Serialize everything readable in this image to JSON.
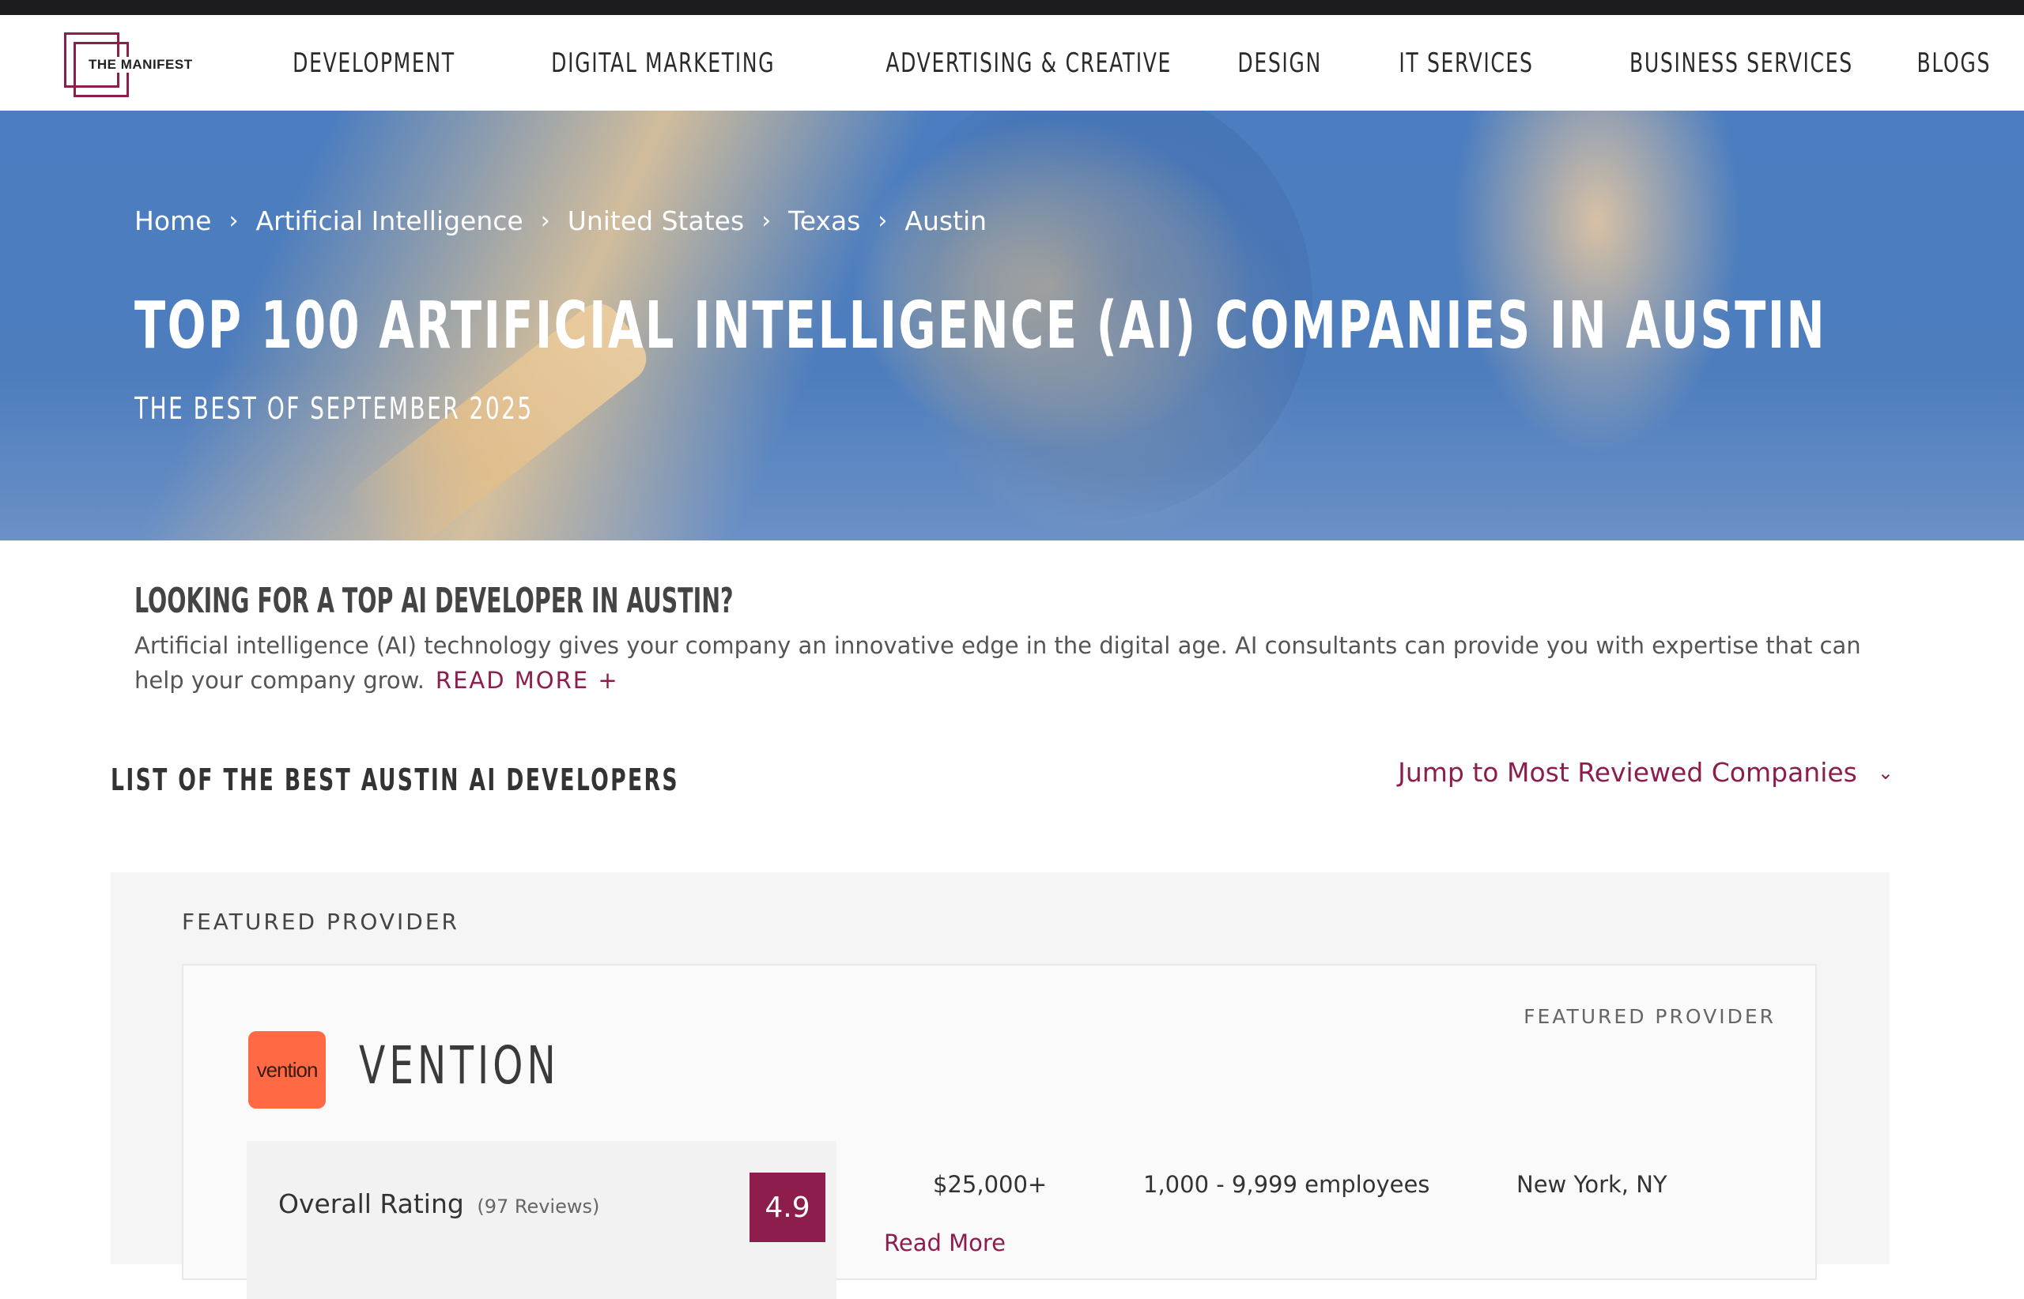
{
  "brand": {
    "logo_text": "THE MANIFEST",
    "accent_color": "#8c1d4d"
  },
  "nav": {
    "items": [
      {
        "label": "DEVELOPMENT"
      },
      {
        "label": "DIGITAL MARKETING"
      },
      {
        "label": "ADVERTISING & CREATIVE"
      },
      {
        "label": "DESIGN"
      },
      {
        "label": "IT SERVICES"
      },
      {
        "label": "BUSINESS SERVICES"
      },
      {
        "label": "BLOGS"
      }
    ]
  },
  "breadcrumb": {
    "items": [
      {
        "label": "Home"
      },
      {
        "label": "Artificial Intelligence"
      },
      {
        "label": "United States"
      },
      {
        "label": "Texas"
      },
      {
        "label": "Austin"
      }
    ],
    "separator_icon": "chevron-right-icon"
  },
  "hero": {
    "title": "TOP 100 ARTIFICIAL INTELLIGENCE (AI) COMPANIES IN AUSTIN",
    "subtitle": "THE BEST OF SEPTEMBER 2025"
  },
  "intro": {
    "heading": "LOOKING FOR A TOP AI DEVELOPER IN AUSTIN?",
    "body": "Artificial intelligence (AI) technology gives your company an innovative edge in the digital age. AI consultants can provide you with expertise that can help your company grow.",
    "read_more": "READ MORE +"
  },
  "list": {
    "heading": "LIST OF THE BEST AUSTIN AI DEVELOPERS",
    "jump_label": "Jump to Most Reviewed Companies",
    "jump_icon": "chevron-down-icon"
  },
  "featured": {
    "section_label": "FEATURED PROVIDER",
    "card": {
      "tag": "FEATURED PROVIDER",
      "logo_text": "vention",
      "logo_color": "#ff6a45",
      "company_name": "VENTION",
      "rating_label": "Overall Rating",
      "review_count": "(97 Reviews)",
      "score": "4.9",
      "min_project": "$25,000+",
      "employees": "1,000 - 9,999 employees",
      "location": "New York, NY",
      "read_more": "Read More"
    }
  }
}
